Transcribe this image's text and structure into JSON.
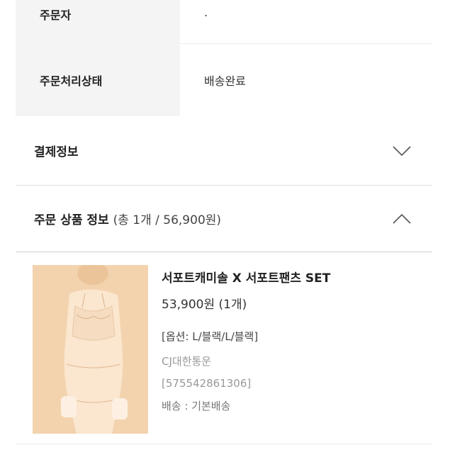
{
  "order_info": {
    "orderer_label": "주문자",
    "orderer_value": ".",
    "status_label": "주문처리상태",
    "status_value": "배송완료"
  },
  "payment_section": {
    "title": "결제정보",
    "toggle_icon": "chevron-down-icon"
  },
  "products_section": {
    "title": "주문 상품 정보",
    "summary": "(총 1개 / 56,900원)",
    "toggle_icon": "chevron-up-icon"
  },
  "product": {
    "name": "서포트캐미솔 X 서포트팬츠 SET",
    "price": "53,900원 (1개)",
    "option": "[옵션: L/블랙/L/블랙]",
    "courier": "CJ대한통운",
    "tracking": "[575542861306]",
    "shipping": "배송 : 기본배송",
    "thumbnail_bg": "#f2d3ae"
  }
}
